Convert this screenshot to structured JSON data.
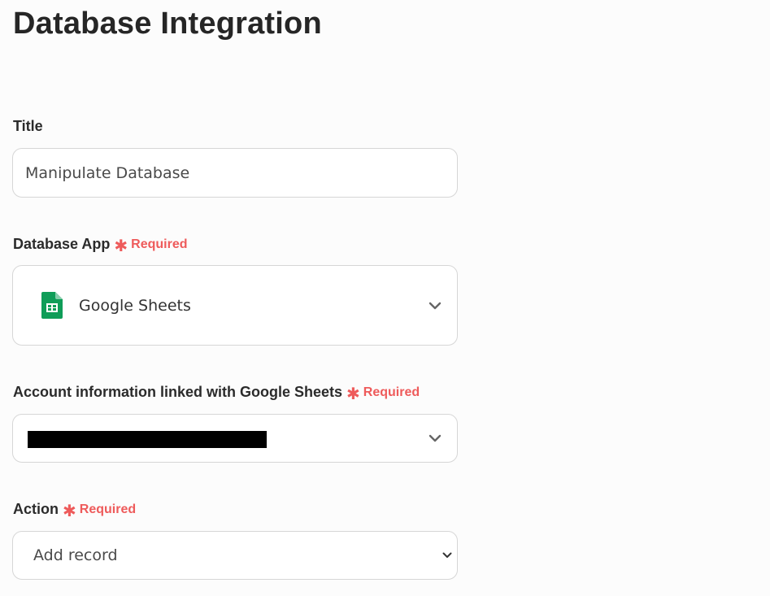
{
  "page": {
    "title": "Database Integration"
  },
  "fields": {
    "title": {
      "label": "Title",
      "value": "Manipulate Database"
    },
    "database_app": {
      "label": "Database App",
      "required_label": "Required",
      "value": "Google Sheets",
      "icon": "google-sheets-icon"
    },
    "account": {
      "label": "Account information linked with Google Sheets",
      "required_label": "Required",
      "value_redacted": true
    },
    "action": {
      "label": "Action",
      "required_label": "Required",
      "value": "Add record"
    }
  },
  "colors": {
    "required": "#ee5b5b",
    "sheets_green": "#0f9d58",
    "border": "#d6d6d6"
  }
}
